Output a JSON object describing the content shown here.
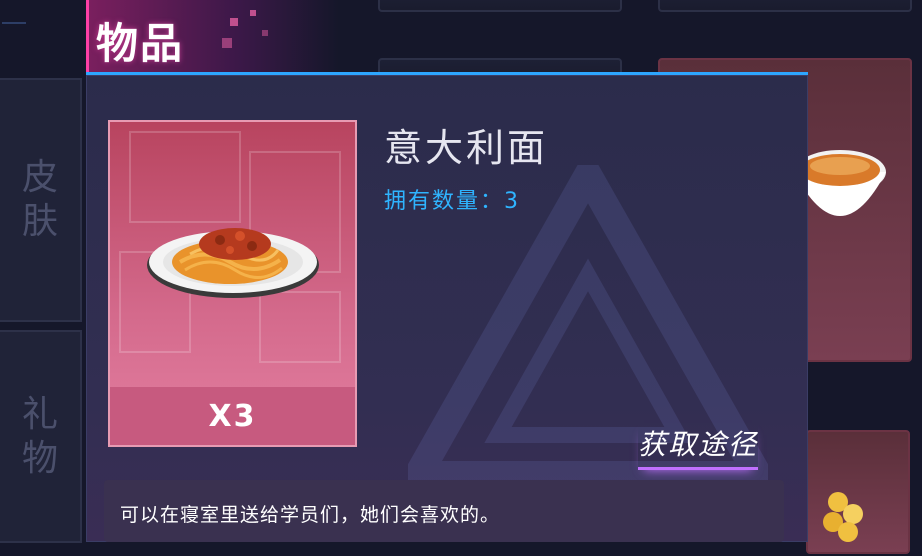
{
  "header": {
    "title": "物品"
  },
  "sidebar": {
    "tabs": [
      {
        "label_line1": "皮",
        "label_line2": "肤"
      },
      {
        "label_line1": "礼",
        "label_line2": "物"
      }
    ]
  },
  "detail": {
    "item_name": "意大利面",
    "owned_label": "拥有数量：",
    "owned_count": "3",
    "quantity_badge": "X3",
    "obtain_link": "获取途径",
    "description": "可以在寝室里送给学员们，她们会喜欢的。",
    "item_icon": "spaghetti-plate-icon"
  },
  "colors": {
    "accent_pink": "#ff3fa6",
    "accent_blue": "#2da6ff",
    "accent_purple": "#c070ff",
    "card_pink": "#d46a8c"
  }
}
